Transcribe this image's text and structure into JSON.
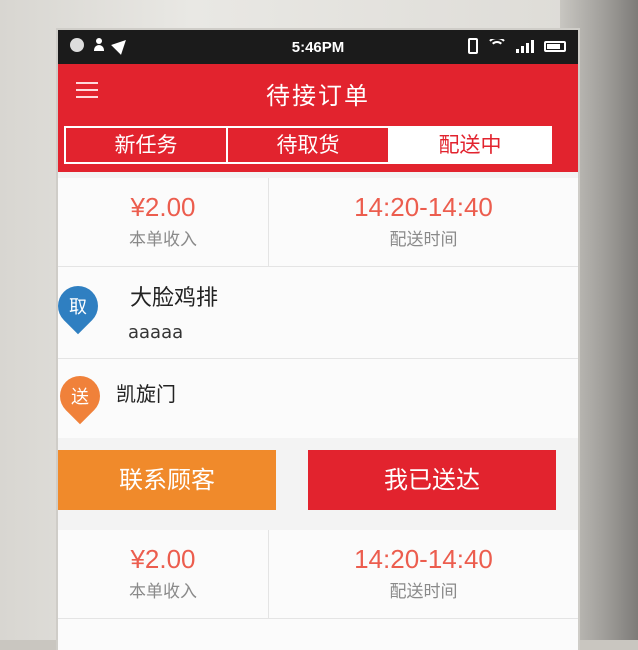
{
  "status_bar": {
    "time": "5:46PM",
    "left_icons": [
      "notification-dot-icon",
      "person-icon",
      "location-arrow-icon"
    ],
    "right_icons": [
      "vibrate-icon",
      "wifi-icon",
      "signal-icon",
      "battery-icon"
    ]
  },
  "header": {
    "title": "待接订单",
    "menu_icon": "hamburger-menu-icon"
  },
  "tabs": [
    {
      "label": "新任务",
      "active": false
    },
    {
      "label": "待取货",
      "active": false
    },
    {
      "label": "配送中",
      "active": true
    }
  ],
  "orders": [
    {
      "income": "¥2.00",
      "income_label": "本单收入",
      "delivery_time": "14:20-14:40",
      "delivery_time_label": "配送时间",
      "pickup_badge": "取",
      "pickup_name": "大脸鸡排",
      "pickup_address": "aaaaa",
      "deliver_badge": "送",
      "deliver_name": "凯旋门",
      "contact_button": "联系顾客",
      "delivered_button": "我已送达"
    },
    {
      "income": "¥2.00",
      "income_label": "本单收入",
      "delivery_time": "14:20-14:40",
      "delivery_time_label": "配送时间"
    }
  ],
  "colors": {
    "primary_red": "#e2232e",
    "accent_orange": "#f08a2b",
    "price_red": "#ec5d4e",
    "pickup_blue": "#2f7fc1",
    "deliver_orange": "#f0813a"
  }
}
